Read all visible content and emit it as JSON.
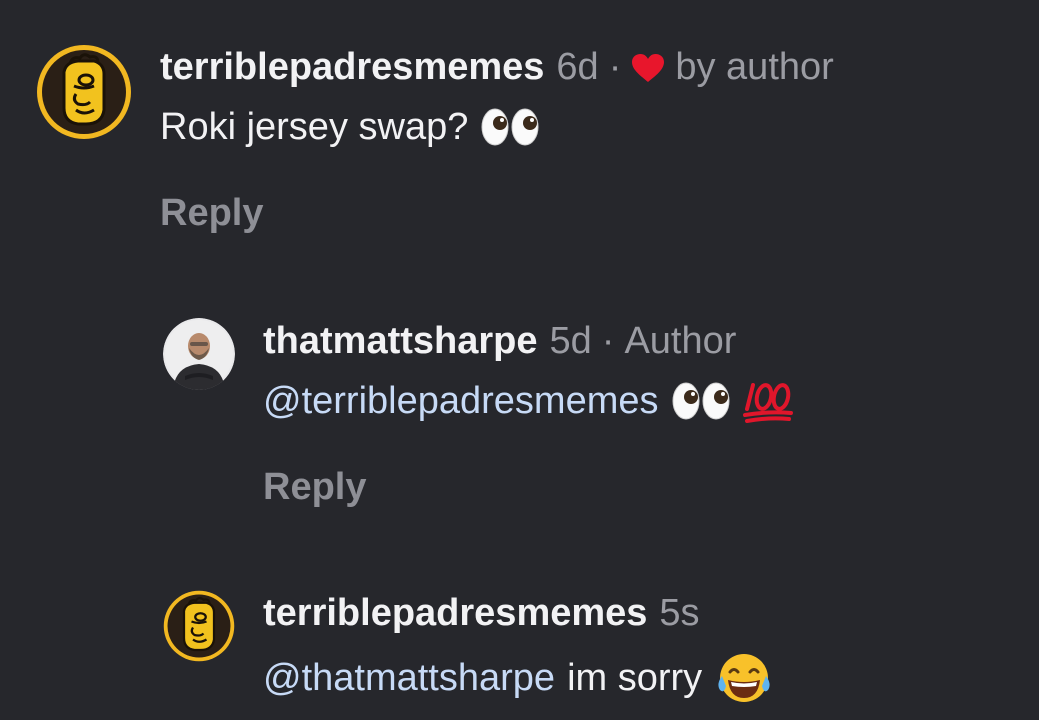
{
  "comments": [
    {
      "username": "terriblepadresmemes",
      "time": "6d",
      "separator": "·",
      "liked_by": "by author",
      "text": "Roki jersey swap?",
      "emojis": [
        "eyes-emoji"
      ],
      "reply_label": "Reply"
    },
    {
      "username": "thatmattsharpe",
      "time": "5d",
      "separator": "·",
      "role": "Author",
      "mention": "@terriblepadresmemes",
      "emojis": [
        "eyes-emoji",
        "hundred-points-emoji"
      ],
      "reply_label": "Reply"
    },
    {
      "username": "terriblepadresmemes",
      "time": "5s",
      "mention": "@thatmattsharpe",
      "text": "im sorry",
      "emojis": [
        "laughing-tears-emoji"
      ]
    }
  ],
  "colors": {
    "background": "#26272c",
    "username": "#f2f2f4",
    "meta": "#9b9ca3",
    "mention": "#c7daf6",
    "heart": "#e8162c",
    "avatar_ring": "#f2b821"
  }
}
